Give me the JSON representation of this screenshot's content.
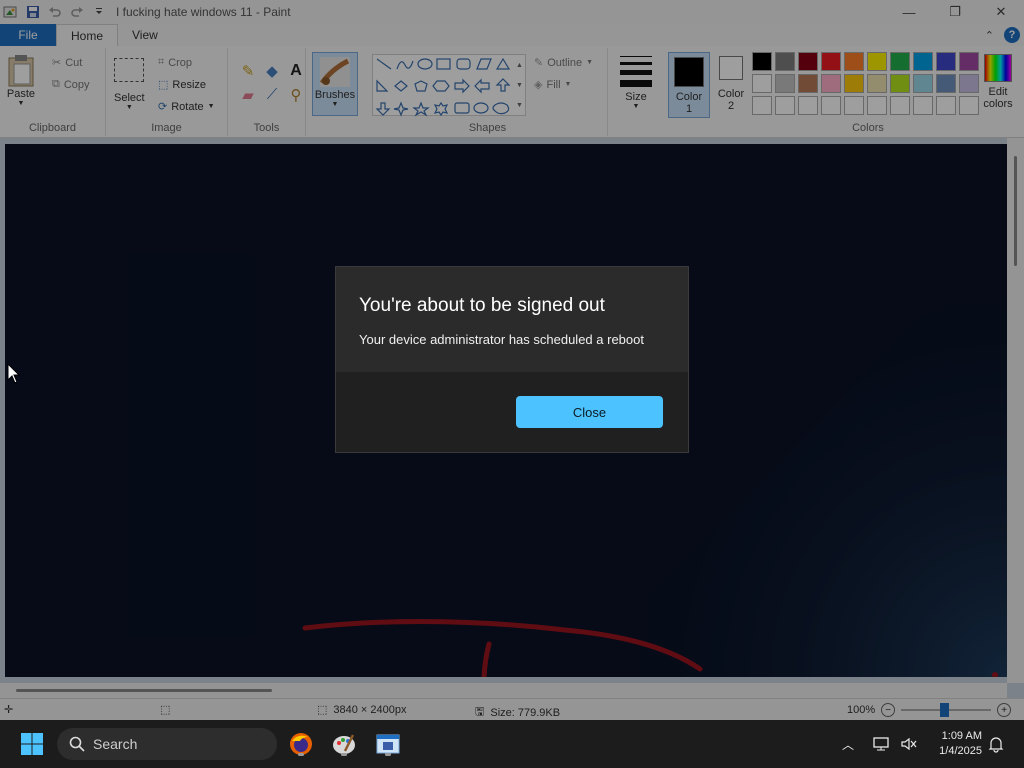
{
  "window": {
    "title": "I fucking hate windows 11 - Paint",
    "controls": [
      "minimize-icon",
      "restore-icon",
      "close-icon"
    ]
  },
  "tabs": [
    {
      "label": "File"
    },
    {
      "label": "Home"
    },
    {
      "label": "View"
    }
  ],
  "ribbon": {
    "clipboard": {
      "paste": "Paste",
      "cut": "Cut",
      "copy": "Copy",
      "group": "Clipboard"
    },
    "image": {
      "select": "Select",
      "crop": "Crop",
      "resize": "Resize",
      "rotate": "Rotate",
      "group": "Image"
    },
    "tools": {
      "group": "Tools"
    },
    "brushes": {
      "label": "Brushes"
    },
    "shapes": {
      "outline": "Outline",
      "fill": "Fill",
      "group": "Shapes"
    },
    "size": {
      "label": "Size"
    },
    "color1": {
      "line1": "Color",
      "line2": "1"
    },
    "color2": {
      "line1": "Color",
      "line2": "2"
    },
    "colors": {
      "group": "Colors",
      "edit_line1": "Edit",
      "edit_line2": "colors"
    },
    "palette": [
      "#000000",
      "#7f7f7f",
      "#880015",
      "#ed1c24",
      "#ff7f27",
      "#fff200",
      "#22b14c",
      "#00a2e8",
      "#3f48cc",
      "#a349a4",
      "#ffffff",
      "#c3c3c3",
      "#b97a57",
      "#ffaec9",
      "#ffc90e",
      "#efe4b0",
      "#b5e61d",
      "#99d9ea",
      "#7092be",
      "#c8bfe7",
      "#ffffff",
      "#ffffff",
      "#ffffff",
      "#ffffff",
      "#ffffff",
      "#ffffff",
      "#ffffff",
      "#ffffff",
      "#ffffff",
      "#ffffff"
    ]
  },
  "status": {
    "dimensions": "3840 × 2400px",
    "size": "Size: 779.9KB",
    "zoom": "100%"
  },
  "dialog": {
    "title": "You're about to be signed out",
    "message": "Your device administrator has scheduled a reboot",
    "close_label": "Close"
  },
  "taskbar": {
    "search_label": "Search",
    "time": "1:09 AM",
    "date": "1/4/2025"
  }
}
